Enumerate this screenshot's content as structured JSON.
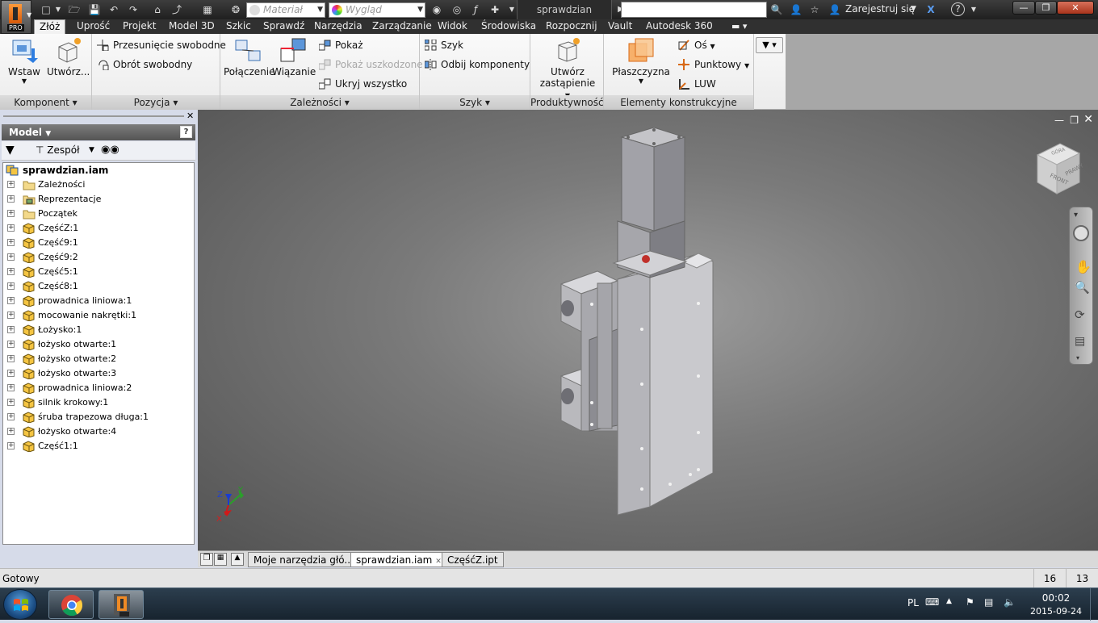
{
  "app": {
    "logo_badge": "PRO",
    "document_name": "sprawdzian",
    "search_value": ""
  },
  "toolbar": {
    "material_placeholder": "Materiał",
    "appearance_placeholder": "Wygląd",
    "signin_label": "Zarejestruj się"
  },
  "menu_tabs": [
    "Złóż",
    "Uprość",
    "Projekt",
    "Model 3D",
    "Szkic",
    "Sprawdź",
    "Narzędzia",
    "Zarządzanie",
    "Widok",
    "Środowiska",
    "Rozpocznij",
    "Vault",
    "Autodesk 360"
  ],
  "active_tab": "Złóż",
  "ribbon": {
    "komponent": {
      "title": "Komponent",
      "insert": "Wstaw",
      "create": "Utwórz..."
    },
    "pozycja": {
      "title": "Pozycja",
      "free_move": "Przesunięcie swobodne",
      "free_rotate": "Obrót swobodny"
    },
    "zaleznosci": {
      "title": "Zależności",
      "join": "Połączenie",
      "constrain": "Wiązanie",
      "show": "Pokaż",
      "show_sick": "Pokaż uszkodzone",
      "hide_all": "Ukryj wszystko"
    },
    "szyk": {
      "title": "Szyk",
      "pattern": "Szyk",
      "mirror": "Odbij komponenty"
    },
    "produktywnosc": {
      "title": "Produktywność",
      "substitute_line1": "Utwórz",
      "substitute_line2": "zastąpienie"
    },
    "elementy": {
      "title": "Elementy konstrukcyjne",
      "plane": "Płaszczyzna",
      "axis": "Oś",
      "point": "Punktowy",
      "ucs": "LUW"
    }
  },
  "browser": {
    "title": "Model",
    "filter": "Zespół",
    "root": "sprawdzian.iam",
    "items": [
      {
        "label": "Zależności",
        "icon": "folder-icon"
      },
      {
        "label": "Reprezentacje",
        "icon": "representations-icon"
      },
      {
        "label": "Początek",
        "icon": "folder-icon"
      },
      {
        "label": "CzęśćZ:1",
        "icon": "part-icon"
      },
      {
        "label": "Część9:1",
        "icon": "part-icon"
      },
      {
        "label": "Część9:2",
        "icon": "part-icon"
      },
      {
        "label": "Część5:1",
        "icon": "part-icon"
      },
      {
        "label": "Część8:1",
        "icon": "part-icon"
      },
      {
        "label": "prowadnica liniowa:1",
        "icon": "part-icon"
      },
      {
        "label": "mocowanie nakrętki:1",
        "icon": "part-icon"
      },
      {
        "label": "Łożysko:1",
        "icon": "part-icon"
      },
      {
        "label": "łożysko otwarte:1",
        "icon": "part-icon"
      },
      {
        "label": "łożysko otwarte:2",
        "icon": "part-icon"
      },
      {
        "label": "łożysko otwarte:3",
        "icon": "part-icon"
      },
      {
        "label": "prowadnica liniowa:2",
        "icon": "part-icon"
      },
      {
        "label": "silnik krokowy:1",
        "icon": "part-icon"
      },
      {
        "label": "śruba trapezowa długa:1",
        "icon": "part-icon"
      },
      {
        "label": "łożysko otwarte:4",
        "icon": "part-icon"
      },
      {
        "label": "Część1:1",
        "icon": "part-icon"
      }
    ]
  },
  "viewcube": {
    "front": "FRONT",
    "right": "PRAWY",
    "top": "GÓRA"
  },
  "triad": {
    "x": "X",
    "y": "Y",
    "z": "Z"
  },
  "doc_tabs": [
    {
      "label": "Moje narzędzia głó...",
      "active": false
    },
    {
      "label": "sprawdzian.iam",
      "active": true
    },
    {
      "label": "CzęśćZ.ipt",
      "active": false
    }
  ],
  "status": {
    "text": "Gotowy",
    "count1": "16",
    "count2": "13"
  },
  "taskbar": {
    "lang": "PL",
    "time": "00:02",
    "date": "2015-09-24"
  },
  "colors": {
    "ribbon_bg": "#f2f2f2",
    "viewport_center": "#9d9d9d",
    "viewport_edge": "#535353",
    "part_yellow": "#f5c542",
    "accent_orange": "#e8731a"
  }
}
